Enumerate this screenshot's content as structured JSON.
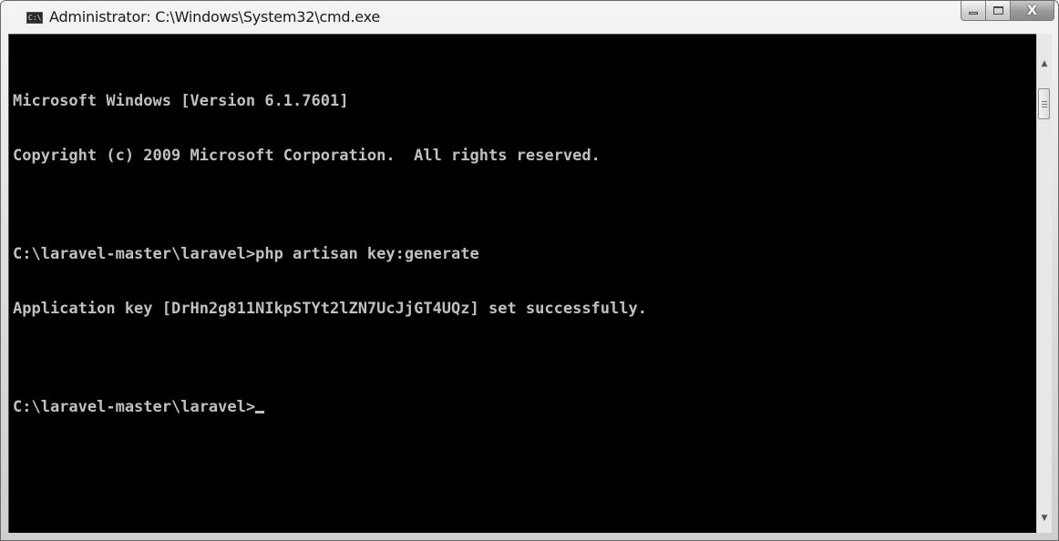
{
  "window": {
    "title": "Administrator: C:\\Windows\\System32\\cmd.exe",
    "app_icon_text": "C:\\",
    "close_glyph": "X"
  },
  "console": {
    "colors": {
      "background": "#000000",
      "foreground": "#c0c0c0"
    },
    "lines": [
      "Microsoft Windows [Version 6.1.7601]",
      "Copyright (c) 2009 Microsoft Corporation.  All rights reserved.",
      "C:\\laravel-master\\laravel>php artisan key:generate",
      "Application key [DrHn2g811NIkpSTYt2lZN7UcJjGT4UQz] set successfully.",
      "C:\\laravel-master\\laravel>"
    ]
  },
  "scrollbar": {
    "up_arrow_icon": "scroll-up-arrow",
    "down_arrow_icon": "scroll-down-arrow",
    "position": 0
  }
}
